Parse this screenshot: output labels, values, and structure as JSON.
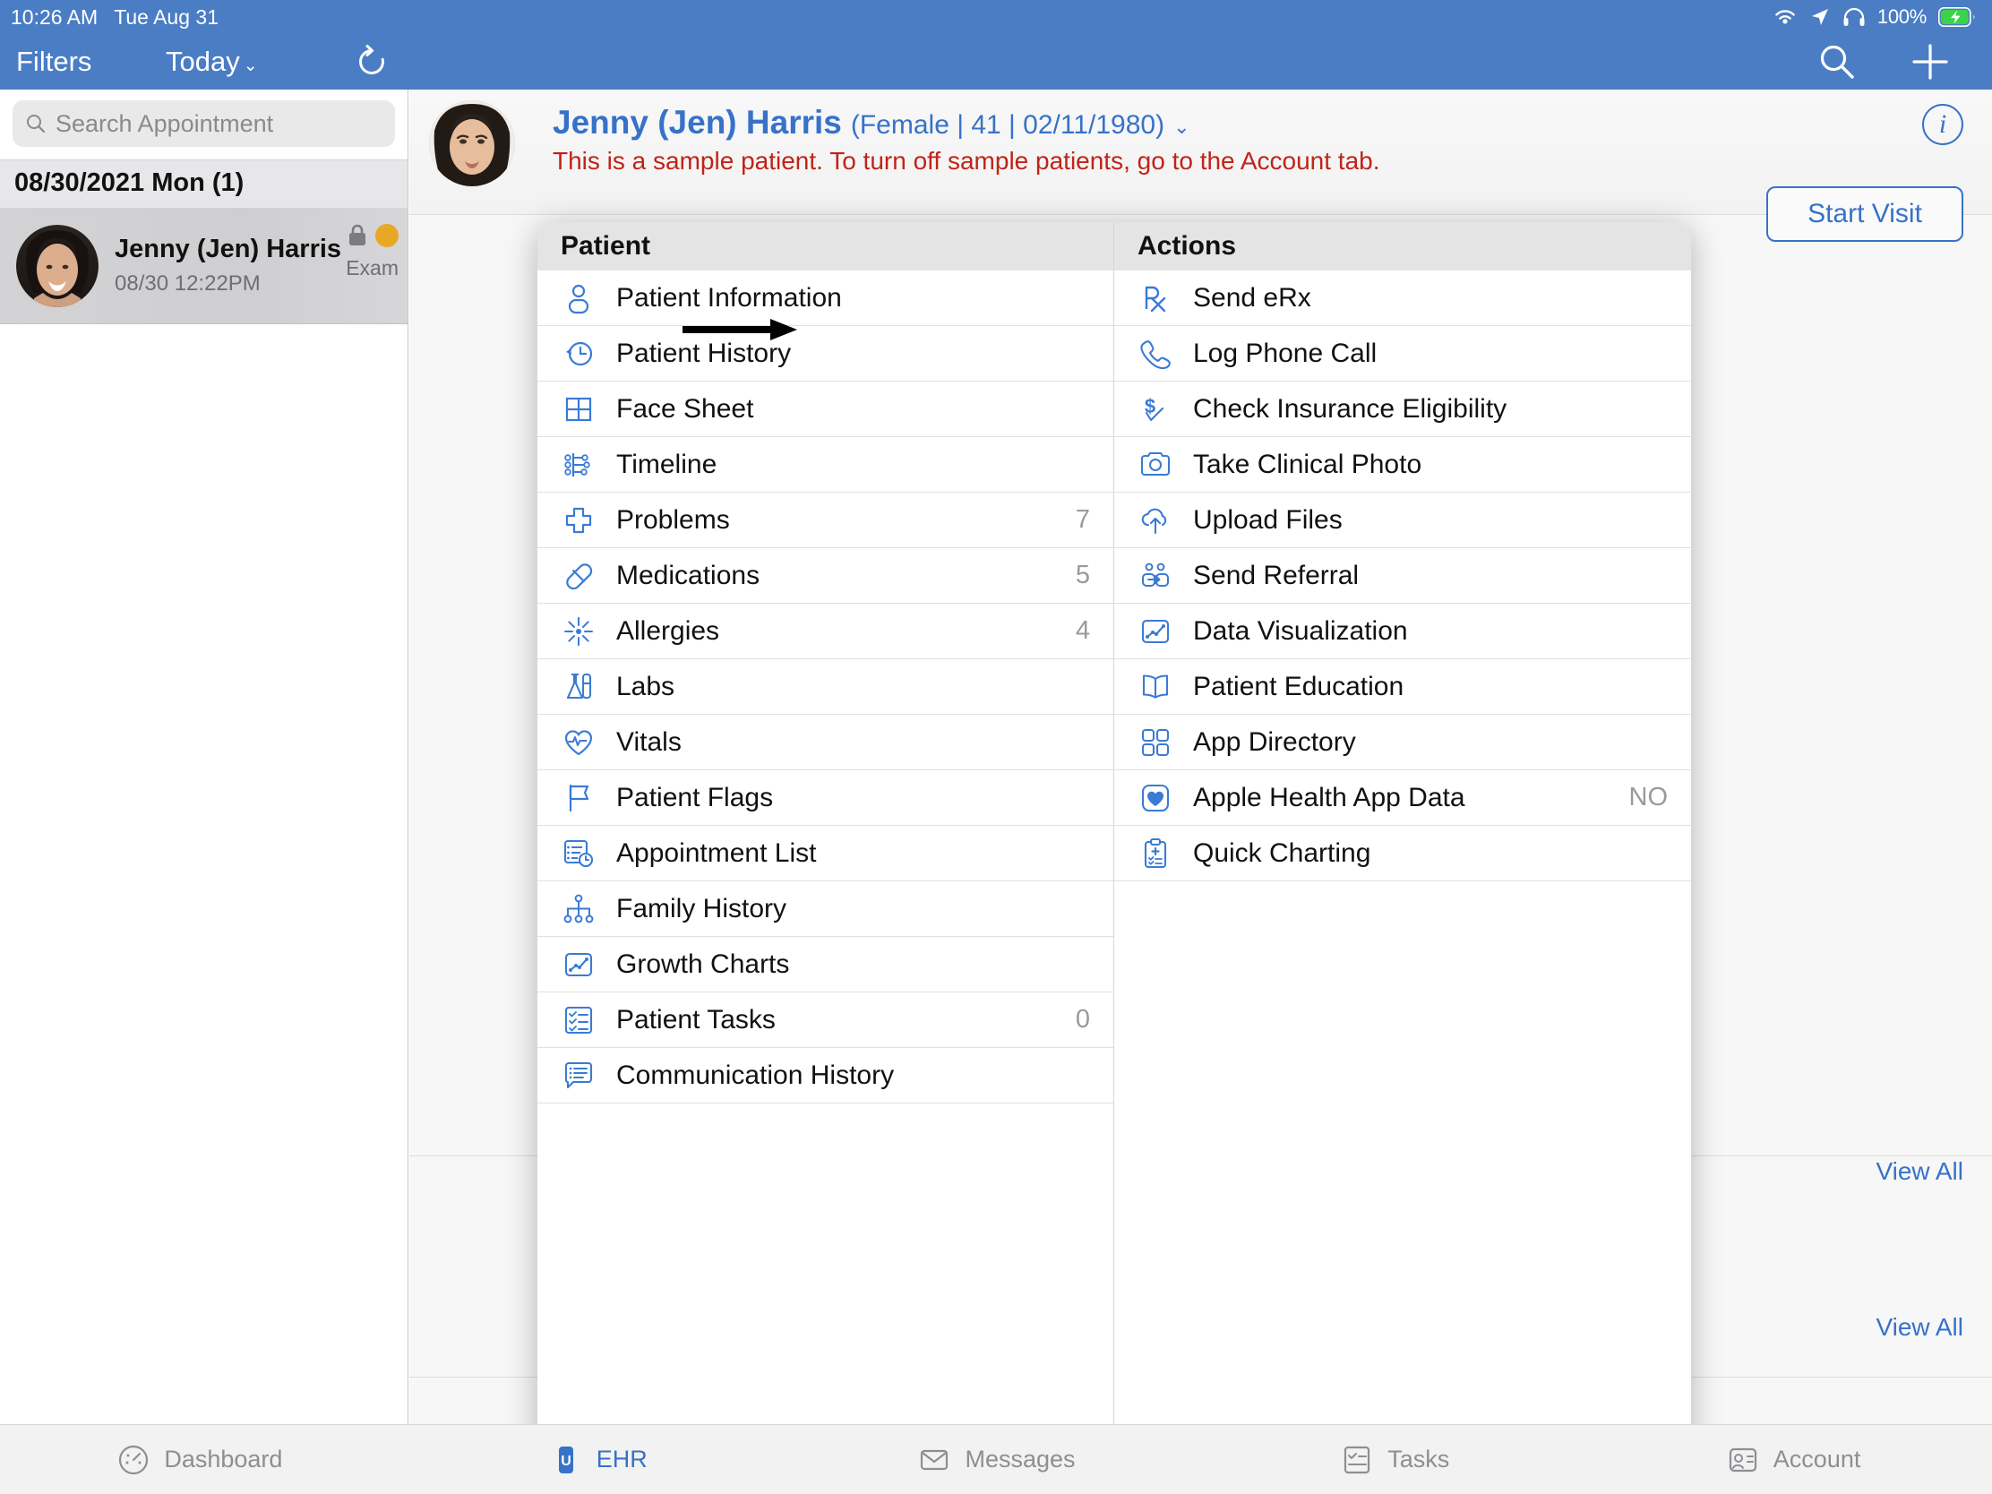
{
  "status_bar": {
    "time": "10:26 AM",
    "date": "Tue Aug 31",
    "battery_percent": "100%",
    "icons": [
      "wifi-icon",
      "location-arrow-icon",
      "headphones-icon",
      "battery-charging-icon"
    ]
  },
  "nav": {
    "filters_label": "Filters",
    "today_label": "Today",
    "today_chevron": "⌄",
    "refresh_icon": "refresh-icon",
    "search_icon": "search-icon",
    "add_icon": "plus-icon"
  },
  "search": {
    "placeholder": "Search Appointment",
    "value": ""
  },
  "appointments": {
    "date_header": "08/30/2021 Mon (1)",
    "rows": [
      {
        "name": "Jenny (Jen) Harris",
        "time": "08/30 12:22PM",
        "status": "Exam",
        "locked": "lock-icon",
        "badge_color": "#e8a825"
      }
    ]
  },
  "patient_header": {
    "name": "Jenny (Jen) Harris",
    "demographics": "(Female | 41 | 02/11/1980)",
    "chevron": "⌄",
    "warning": "This is a sample patient. To turn off sample patients, go to the Account tab.",
    "info_icon": "i",
    "start_visit_label": "Start Visit",
    "accent_color": "#3772c8",
    "warning_color": "#c02418"
  },
  "right_content": {
    "view_all_label_1": "View All",
    "view_all_label_2": "View All"
  },
  "popup": {
    "patient_column": {
      "title": "Patient",
      "items": [
        {
          "label": "Patient Information",
          "icon": "person-icon",
          "count": ""
        },
        {
          "label": "Patient History",
          "icon": "clock-history-icon",
          "count": ""
        },
        {
          "label": "Face Sheet",
          "icon": "grid-2x2-icon",
          "count": ""
        },
        {
          "label": "Timeline",
          "icon": "timeline-icon",
          "count": ""
        },
        {
          "label": "Problems",
          "icon": "medical-cross-icon",
          "count": "7"
        },
        {
          "label": "Medications",
          "icon": "pill-icon",
          "count": "5"
        },
        {
          "label": "Allergies",
          "icon": "allergy-burst-icon",
          "count": "4"
        },
        {
          "label": "Labs",
          "icon": "lab-flask-icon",
          "count": ""
        },
        {
          "label": "Vitals",
          "icon": "heart-pulse-icon",
          "count": ""
        },
        {
          "label": "Patient Flags",
          "icon": "flag-icon",
          "count": ""
        },
        {
          "label": "Appointment List",
          "icon": "list-clock-icon",
          "count": ""
        },
        {
          "label": "Family History",
          "icon": "family-tree-icon",
          "count": ""
        },
        {
          "label": "Growth Charts",
          "icon": "chart-line-icon",
          "count": ""
        },
        {
          "label": "Patient Tasks",
          "icon": "checklist-icon",
          "count": "0"
        },
        {
          "label": "Communication History",
          "icon": "chat-list-icon",
          "count": ""
        }
      ]
    },
    "actions_column": {
      "title": "Actions",
      "items": [
        {
          "label": "Send eRx",
          "icon": "rx-icon",
          "count": ""
        },
        {
          "label": "Log Phone Call",
          "icon": "phone-icon",
          "count": ""
        },
        {
          "label": "Check Insurance Eligibility",
          "icon": "dollar-check-icon",
          "count": ""
        },
        {
          "label": "Take Clinical Photo",
          "icon": "camera-icon",
          "count": ""
        },
        {
          "label": "Upload Files",
          "icon": "cloud-upload-icon",
          "count": ""
        },
        {
          "label": "Send Referral",
          "icon": "referral-icon",
          "count": ""
        },
        {
          "label": "Data Visualization",
          "icon": "chart-line-icon",
          "count": ""
        },
        {
          "label": "Patient Education",
          "icon": "book-icon",
          "count": ""
        },
        {
          "label": "App Directory",
          "icon": "grid-apps-icon",
          "count": ""
        },
        {
          "label": "Apple Health App Data",
          "icon": "heart-square-icon",
          "count": "NO"
        },
        {
          "label": "Quick Charting",
          "icon": "clipboard-plus-icon",
          "count": ""
        }
      ]
    },
    "pointer_arrow": "right-arrow-annotation"
  },
  "tabbar": {
    "items": [
      {
        "label": "Dashboard",
        "icon": "gauge-icon",
        "active": false
      },
      {
        "label": "EHR",
        "icon": "ehr-icon",
        "active": true
      },
      {
        "label": "Messages",
        "icon": "message-icon",
        "active": false
      },
      {
        "label": "Tasks",
        "icon": "tasks-icon",
        "active": false
      },
      {
        "label": "Account",
        "icon": "account-icon",
        "active": false
      }
    ]
  }
}
